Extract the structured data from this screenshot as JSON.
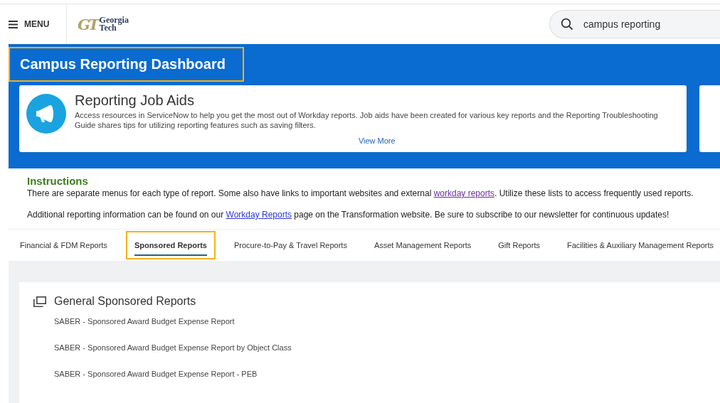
{
  "header": {
    "menu_label": "MENU",
    "logo": {
      "monogram": "GT",
      "name_lines": [
        "Georgia",
        "Tech"
      ]
    },
    "search": {
      "value": "campus reporting"
    }
  },
  "banner": {
    "title": "Campus Reporting Dashboard",
    "title_highlighted": true,
    "card": {
      "title": "Reporting Job Aids",
      "text": "Access resources in ServiceNow to help you get the most out of Workday reports. Job aids have been created for various key reports and the Reporting Troubleshooting Guide shares tips for utilizing reporting features such as saving filters.",
      "link": "View More"
    }
  },
  "instructions": {
    "heading": "Instructions",
    "paragraphs": [
      {
        "before": "There are separate menus for each type of report. Some also have links to important websites and external ",
        "link": "workday reports",
        "link_visited": true,
        "after": ". Utilize these lists to access frequently used reports."
      },
      {
        "before": "Additional reporting information can be found on our ",
        "link": "Workday Reports",
        "link_visited": false,
        "after": " page on the Transformation website. Be sure to subscribe to our newsletter for continuous updates!"
      }
    ]
  },
  "tabs": [
    {
      "label": "Financial & FDM Reports",
      "selected": false
    },
    {
      "label": "Sponsored Reports",
      "selected": true
    },
    {
      "label": "Procure-to-Pay & Travel Reports",
      "selected": false
    },
    {
      "label": "Asset Management Reports",
      "selected": false
    },
    {
      "label": "Gift Reports",
      "selected": false
    },
    {
      "label": "Facilities & Auxiliary Management Reports",
      "selected": false
    }
  ],
  "section": {
    "title": "General Sponsored Reports",
    "items": [
      "SABER - Sponsored Award Budget Expense Report",
      "SABER - Sponsored Award Budget Expense Report by Object Class",
      "SABER - Sponsored Award Budget Expense Report - PEB"
    ]
  }
}
